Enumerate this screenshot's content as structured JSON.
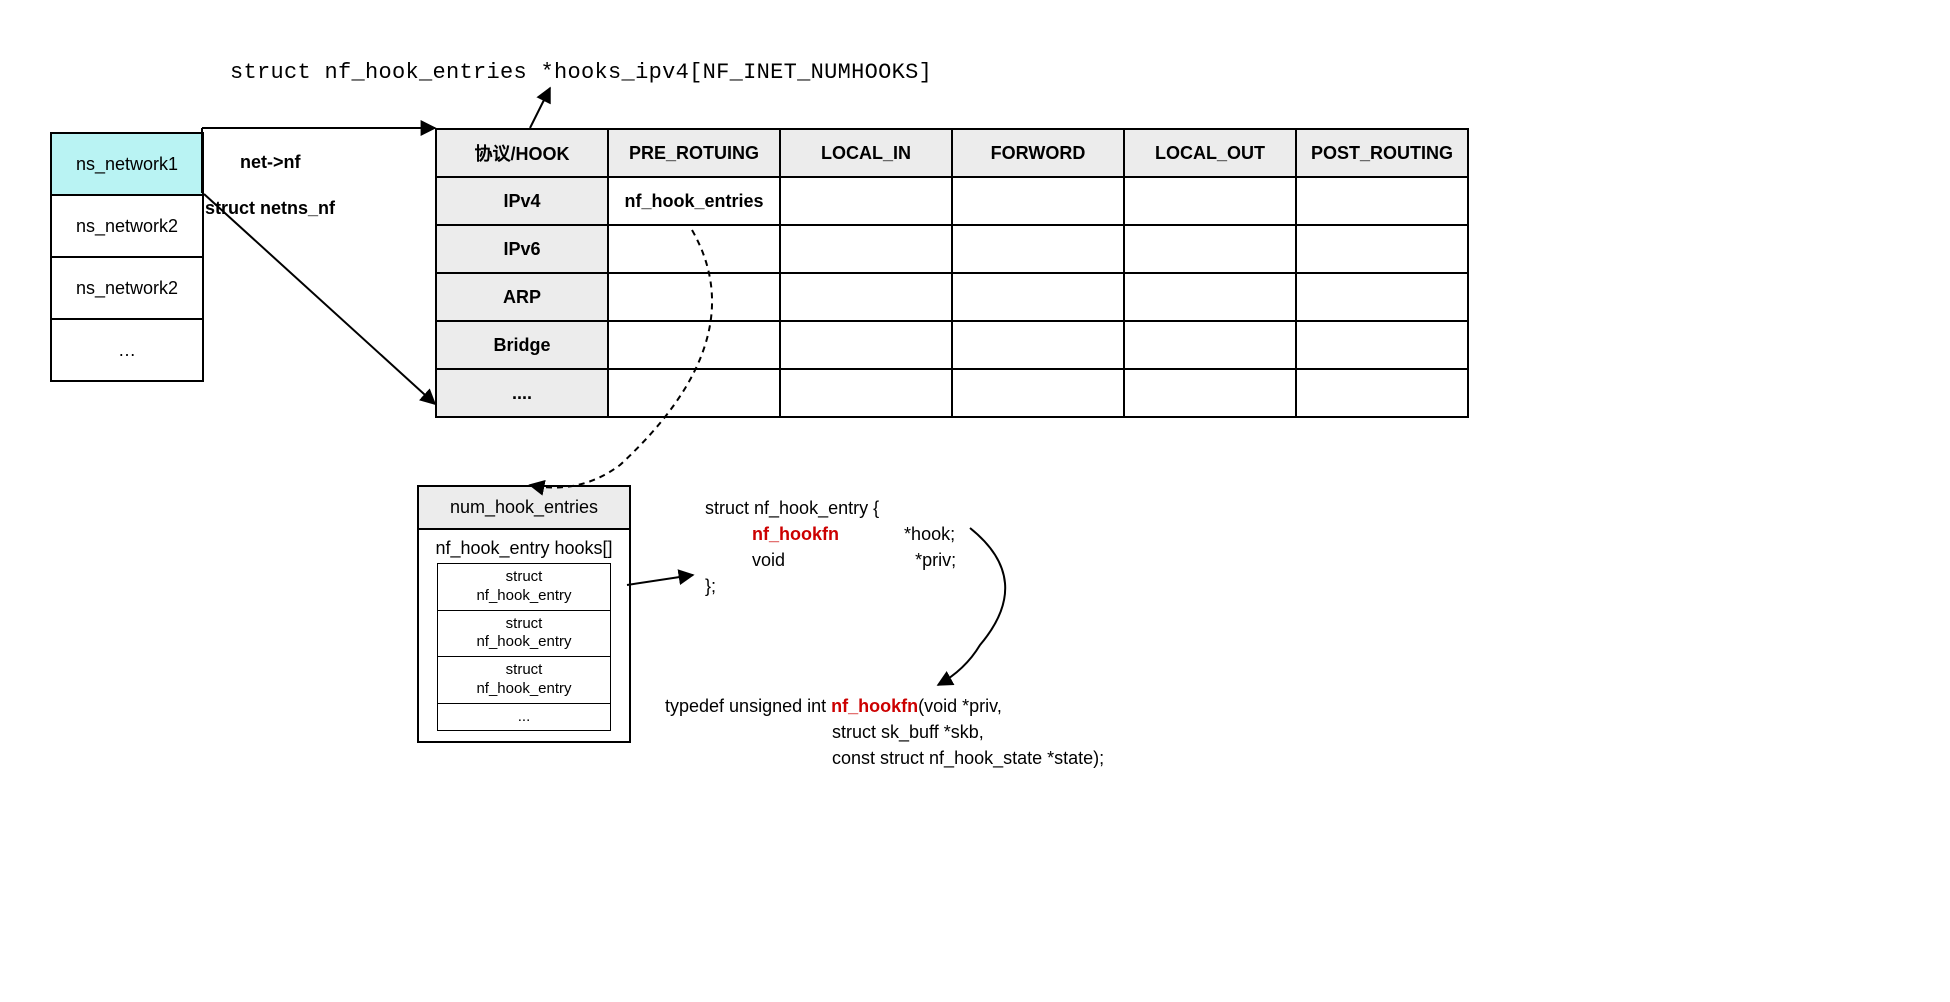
{
  "title_code": "struct nf_hook_entries *hooks_ipv4[NF_INET_NUMHOOKS]",
  "ns_list": [
    "ns_network1",
    "ns_network2",
    "ns_network2",
    "…"
  ],
  "ns_active_index": 0,
  "labels": {
    "net_nf": "net->nf",
    "struct_netns_nf": "struct netns_nf"
  },
  "hook_table": {
    "headers": [
      "协议/HOOK",
      "PRE_ROTUING",
      "LOCAL_IN",
      "FORWORD",
      "LOCAL_OUT",
      "POST_ROUTING"
    ],
    "rows": [
      {
        "proto": "IPv4",
        "cells": [
          "nf_hook_entries",
          "",
          "",
          "",
          ""
        ]
      },
      {
        "proto": "IPv6",
        "cells": [
          "",
          "",
          "",
          "",
          ""
        ]
      },
      {
        "proto": "ARP",
        "cells": [
          "",
          "",
          "",
          "",
          ""
        ]
      },
      {
        "proto": "Bridge",
        "cells": [
          "",
          "",
          "",
          "",
          ""
        ]
      },
      {
        "proto": "....",
        "cells": [
          "",
          "",
          "",
          "",
          ""
        ]
      }
    ]
  },
  "entry_box": {
    "header": "num_hook_entries",
    "subhead": "nf_hook_entry hooks[]",
    "inner_items": [
      "struct\nnf_hook_entry",
      "struct\nnf_hook_entry",
      "struct\nnf_hook_entry",
      "..."
    ]
  },
  "struct_code": {
    "line1": "struct nf_hook_entry {",
    "type1": "nf_hookfn",
    "field1": "*hook;",
    "type2": "void",
    "field2": "*priv;",
    "close": "};"
  },
  "typedef_code": {
    "prefix": "typedef unsigned int ",
    "name": "nf_hookfn",
    "rest1": "(void *priv,",
    "rest2": "struct sk_buff *skb,",
    "rest3": "const struct nf_hook_state *state);"
  }
}
